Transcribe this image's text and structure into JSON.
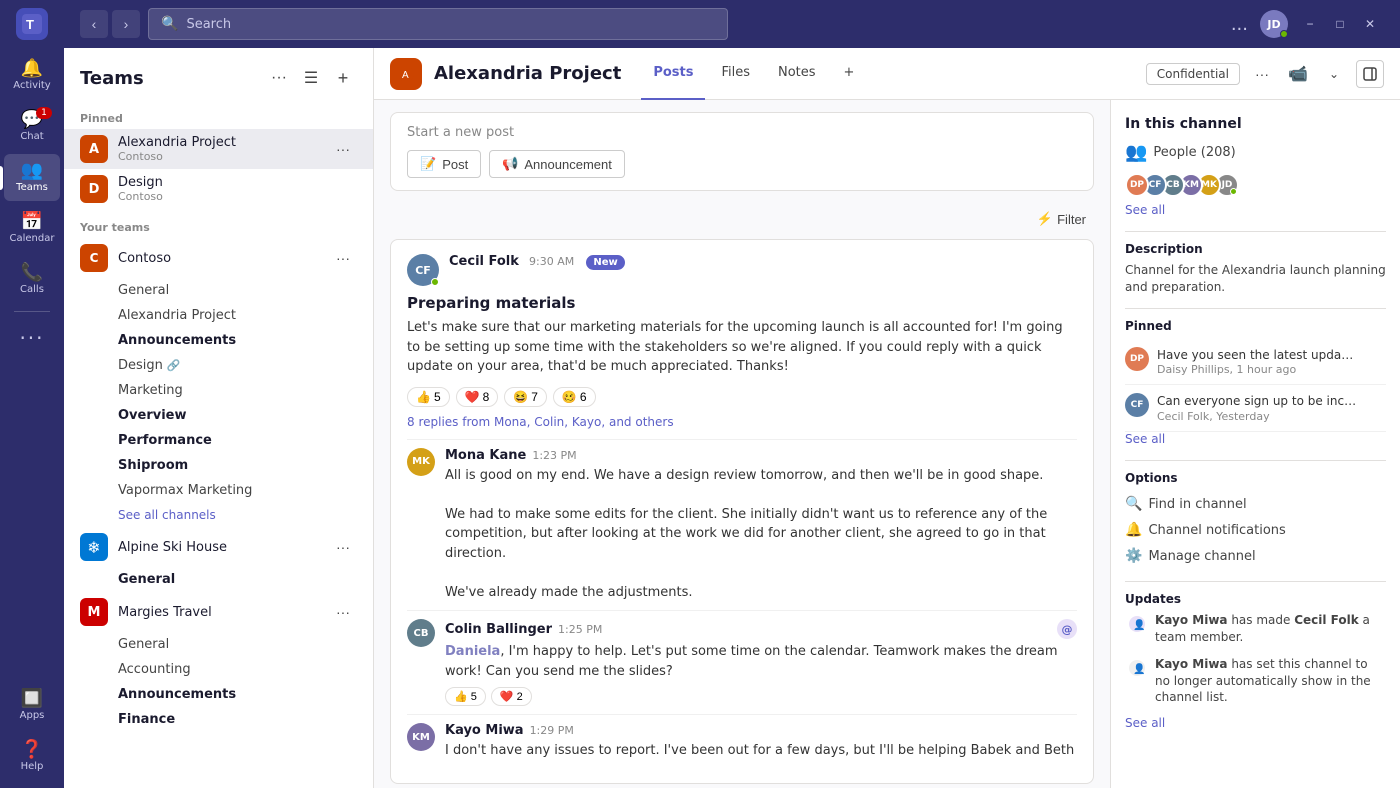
{
  "app": {
    "title": "Microsoft Teams"
  },
  "topbar": {
    "search_placeholder": "Search",
    "user_initials": "JD",
    "more_options": "...",
    "minimize": "−",
    "maximize": "□",
    "close": "✕"
  },
  "nav": {
    "logo_letter": "T",
    "items": [
      {
        "id": "activity",
        "label": "Activity",
        "icon": "🔔",
        "badge": null
      },
      {
        "id": "chat",
        "label": "Chat",
        "icon": "💬",
        "badge": "1"
      },
      {
        "id": "teams",
        "label": "Teams",
        "icon": "👥",
        "badge": null,
        "active": true
      },
      {
        "id": "calendar",
        "label": "Calendar",
        "icon": "📅",
        "badge": null
      },
      {
        "id": "calls",
        "label": "Calls",
        "icon": "📞",
        "badge": null
      },
      {
        "id": "more",
        "label": "...",
        "icon": "···",
        "badge": null
      }
    ],
    "apps_label": "Apps",
    "help_label": "Help"
  },
  "sidebar": {
    "title": "Teams",
    "pinned_label": "Pinned",
    "your_teams_label": "Your teams",
    "pinned_teams": [
      {
        "id": "alexandria",
        "name": "Alexandria Project",
        "sub": "Contoso",
        "color": "#cc4400",
        "initial": "A"
      },
      {
        "id": "design",
        "name": "Design",
        "sub": "Contoso",
        "color": "#cc4400",
        "initial": "D"
      }
    ],
    "teams": [
      {
        "id": "contoso",
        "name": "Contoso",
        "color": "#cc4400",
        "initial": "C",
        "expanded": true,
        "channels": [
          {
            "name": "General",
            "bold": false
          },
          {
            "name": "Alexandria Project",
            "bold": false
          },
          {
            "name": "Announcements",
            "bold": true,
            "active": true
          },
          {
            "name": "Design",
            "bold": false,
            "hasIcon": true
          },
          {
            "name": "Marketing",
            "bold": false
          },
          {
            "name": "Overview",
            "bold": true
          },
          {
            "name": "Performance",
            "bold": true
          },
          {
            "name": "Shiproom",
            "bold": true
          },
          {
            "name": "Vapormax Marketing",
            "bold": false
          }
        ],
        "see_all": "See all channels"
      },
      {
        "id": "alpine",
        "name": "Alpine Ski House",
        "color": "#0078d4",
        "initial": "❄",
        "expanded": true,
        "channels": [
          {
            "name": "General",
            "bold": true
          }
        ]
      },
      {
        "id": "margies",
        "name": "Margies Travel",
        "color": "#cc0000",
        "initial": "M",
        "expanded": true,
        "channels": [
          {
            "name": "General",
            "bold": false
          },
          {
            "name": "Accounting",
            "bold": false
          },
          {
            "name": "Announcements",
            "bold": true
          },
          {
            "name": "Finance",
            "bold": true
          }
        ]
      }
    ]
  },
  "channel": {
    "icon": "🔷",
    "name": "Alexandria Project",
    "tabs": [
      {
        "label": "Posts",
        "active": true
      },
      {
        "label": "Files",
        "active": false
      },
      {
        "label": "Notes",
        "active": false
      },
      {
        "label": "+",
        "active": false
      }
    ],
    "confidential_label": "Confidential",
    "new_post_placeholder": "Start a new post",
    "post_btn": "Post",
    "announcement_btn": "Announcement",
    "filter_btn": "Filter"
  },
  "messages": [
    {
      "id": "msg1",
      "author": "Cecil Folk",
      "author_initials": "CF",
      "avatar_color": "#5b7fa6",
      "time": "9:30 AM",
      "is_new": true,
      "new_label": "New",
      "title": "Preparing materials",
      "body": "Let's make sure that our marketing materials for the upcoming launch is all accounted for! I'm going to be setting up some time with the stakeholders so we're aligned. If you could reply with a quick update on your area, that'd be much appreciated. Thanks!",
      "reactions": [
        {
          "emoji": "👍",
          "count": "5"
        },
        {
          "emoji": "❤️",
          "count": "8"
        },
        {
          "emoji": "😆",
          "count": "7"
        },
        {
          "emoji": "🥴",
          "count": "6"
        }
      ],
      "replies_text": "8 replies from Mona, Colin, Kayo, and others",
      "replies": [
        {
          "author": "Mona Kane",
          "initials": "MK",
          "avatar_color": "#d4a017",
          "time": "1:23 PM",
          "body": "All is good on my end. We have a design review tomorrow, and then we'll be in good shape.\n\nWe had to make some edits for the client. She initially didn't want us to reference any of the competition, but after looking at the work we did for another client, she agreed to go in that direction.\n\nWe've already made the adjustments.",
          "reactions": [],
          "has_at": false
        },
        {
          "author": "Colin Ballinger",
          "initials": "CB",
          "avatar_color": "#607d8b",
          "time": "1:25 PM",
          "mention": "Daniela",
          "body": ", I'm happy to help. Let's put some time on the calendar. Teamwork makes the dream work! Can you send me the slides?",
          "reactions": [
            {
              "emoji": "👍",
              "count": "5"
            },
            {
              "emoji": "❤️",
              "count": "2"
            }
          ],
          "has_at": true
        },
        {
          "author": "Kayo Miwa",
          "initials": "KM",
          "avatar_color": "#7b6ea6",
          "time": "1:29 PM",
          "body": "I don't have any issues to report. I've been out for a few days, but I'll be helping Babek and Beth",
          "reactions": [],
          "has_at": false
        }
      ]
    }
  ],
  "right_panel": {
    "section_title": "In this channel",
    "people_label": "People (208)",
    "see_all": "See all",
    "description_title": "Description",
    "description_text": "Channel for the Alexandria launch planning and preparation.",
    "pinned_title": "Pinned",
    "pinned_items": [
      {
        "text": "Have you seen the latest updates...",
        "meta": "Daisy Phillips, 1 hour ago",
        "initials": "DP",
        "color": "#e07b54"
      },
      {
        "text": "Can everyone sign up to be inclu...",
        "meta": "Cecil Folk, Yesterday",
        "initials": "CF",
        "color": "#5b7fa6"
      }
    ],
    "options_title": "Options",
    "options": [
      {
        "icon": "🔍",
        "label": "Find in channel"
      },
      {
        "icon": "🔔",
        "label": "Channel notifications"
      },
      {
        "icon": "⚙️",
        "label": "Manage channel"
      }
    ],
    "updates_title": "Updates",
    "updates": [
      {
        "icon": "👤",
        "text_parts": [
          {
            "text": "Kayo Miwa",
            "bold": true
          },
          {
            "text": " has made "
          },
          {
            "text": "Cecil Folk",
            "bold": true
          },
          {
            "text": " a team member."
          }
        ]
      },
      {
        "icon": "👤",
        "text_parts": [
          {
            "text": "Kayo Miwa",
            "bold": true
          },
          {
            "text": " has set this channel to no longer automatically show in the channel list."
          }
        ]
      }
    ]
  }
}
